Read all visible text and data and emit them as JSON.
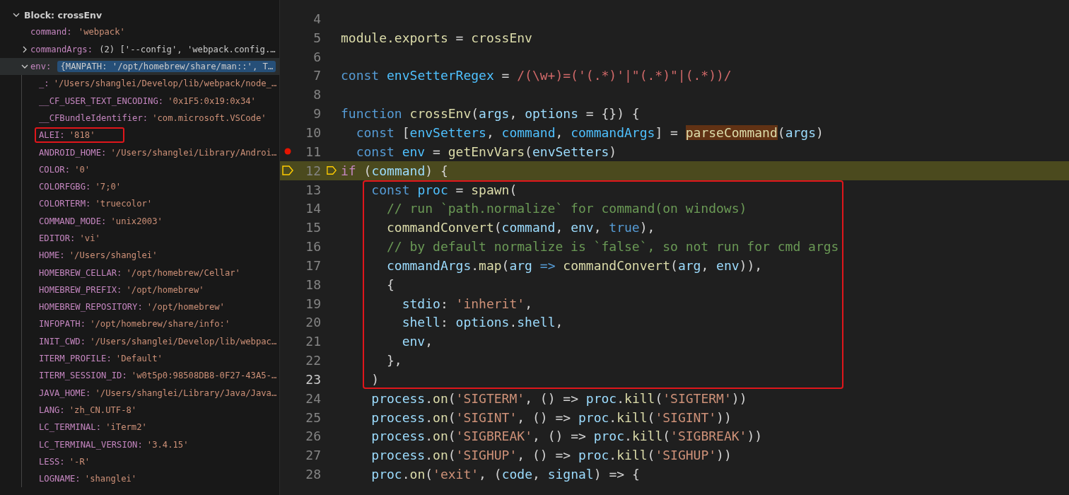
{
  "variables": {
    "scopes": [
      {
        "label": "Block: crossEnv",
        "expanded": true,
        "children": [
          {
            "name": "command:",
            "value": "'webpack'",
            "selected": false,
            "annotated": false
          },
          {
            "name": "commandArgs:",
            "value": "(2) ['--config', 'webpack.config.…",
            "expanded": false,
            "selected": false,
            "annotated": false
          },
          {
            "name": "env:",
            "value": "{MANPATH: '/opt/homebrew/share/man::', T…",
            "expanded": true,
            "selected": true,
            "annotated": false,
            "children": [
              {
                "name": "_:",
                "value": "'/Users/shanglei/Develop/lib/webpack/node_…",
                "selected": false,
                "annotated": false
              },
              {
                "name": "__CF_USER_TEXT_ENCODING:",
                "value": "'0x1F5:0x19:0x34'",
                "selected": false,
                "annotated": false
              },
              {
                "name": "__CFBundleIdentifier:",
                "value": "'com.microsoft.VSCode'",
                "selected": false,
                "annotated": false
              },
              {
                "name": "ALEI:",
                "value": "'818'",
                "selected": false,
                "annotated": true
              },
              {
                "name": "ANDROID_HOME:",
                "value": "'/Users/shanglei/Library/Androi…",
                "selected": false,
                "annotated": false
              },
              {
                "name": "COLOR:",
                "value": "'0'",
                "selected": false,
                "annotated": false
              },
              {
                "name": "COLORFGBG:",
                "value": "'7;0'",
                "selected": false,
                "annotated": false
              },
              {
                "name": "COLORTERM:",
                "value": "'truecolor'",
                "selected": false,
                "annotated": false
              },
              {
                "name": "COMMAND_MODE:",
                "value": "'unix2003'",
                "selected": false,
                "annotated": false
              },
              {
                "name": "EDITOR:",
                "value": "'vi'",
                "selected": false,
                "annotated": false
              },
              {
                "name": "HOME:",
                "value": "'/Users/shanglei'",
                "selected": false,
                "annotated": false
              },
              {
                "name": "HOMEBREW_CELLAR:",
                "value": "'/opt/homebrew/Cellar'",
                "selected": false,
                "annotated": false
              },
              {
                "name": "HOMEBREW_PREFIX:",
                "value": "'/opt/homebrew'",
                "selected": false,
                "annotated": false
              },
              {
                "name": "HOMEBREW_REPOSITORY:",
                "value": "'/opt/homebrew'",
                "selected": false,
                "annotated": false
              },
              {
                "name": "INFOPATH:",
                "value": "'/opt/homebrew/share/info:'",
                "selected": false,
                "annotated": false
              },
              {
                "name": "INIT_CWD:",
                "value": "'/Users/shanglei/Develop/lib/webpac…",
                "selected": false,
                "annotated": false
              },
              {
                "name": "ITERM_PROFILE:",
                "value": "'Default'",
                "selected": false,
                "annotated": false
              },
              {
                "name": "ITERM_SESSION_ID:",
                "value": "'w0t5p0:98508DB8-0F27-43A5-…",
                "selected": false,
                "annotated": false
              },
              {
                "name": "JAVA_HOME:",
                "value": "'/Users/shanglei/Library/Java/Java…",
                "selected": false,
                "annotated": false
              },
              {
                "name": "LANG:",
                "value": "'zh_CN.UTF-8'",
                "selected": false,
                "annotated": false
              },
              {
                "name": "LC_TERMINAL:",
                "value": "'iTerm2'",
                "selected": false,
                "annotated": false
              },
              {
                "name": "LC_TERMINAL_VERSION:",
                "value": "'3.4.15'",
                "selected": false,
                "annotated": false
              },
              {
                "name": "LESS:",
                "value": "'-R'",
                "selected": false,
                "annotated": false
              },
              {
                "name": "LOGNAME:",
                "value": "'shanglei'",
                "selected": false,
                "annotated": false
              }
            ]
          }
        ]
      }
    ]
  },
  "editor": {
    "lines": [
      {
        "number": "4",
        "breakpoint": false,
        "current": false,
        "boxed": false
      },
      {
        "number": "5",
        "breakpoint": false,
        "current": false,
        "boxed": false,
        "tokens": [
          {
            "text": "module.exports",
            "kind": "fn"
          },
          {
            "text": " = ",
            "kind": "punct"
          },
          {
            "text": "crossEnv",
            "kind": "fn"
          }
        ]
      },
      {
        "number": "6",
        "breakpoint": false,
        "current": false,
        "boxed": false
      },
      {
        "number": "7",
        "breakpoint": false,
        "current": false,
        "boxed": false,
        "tokens": [
          {
            "text": "const ",
            "kind": "kw"
          },
          {
            "text": "envSetterRegex",
            "kind": "const"
          },
          {
            "text": " = ",
            "kind": "punct"
          },
          {
            "text": "/(\\w+)=('(.*)'|\"(.*)\"|(.*))/",
            "kind": "regex"
          }
        ]
      },
      {
        "number": "8",
        "breakpoint": false,
        "current": false,
        "boxed": false
      },
      {
        "number": "9",
        "breakpoint": false,
        "current": false,
        "boxed": false,
        "tokens": [
          {
            "text": "function ",
            "kind": "kw"
          },
          {
            "text": "crossEnv",
            "kind": "fn"
          },
          {
            "text": "(",
            "kind": "punct"
          },
          {
            "text": "args",
            "kind": "var"
          },
          {
            "text": ", ",
            "kind": "punct"
          },
          {
            "text": "options",
            "kind": "var"
          },
          {
            "text": " = {}) {",
            "kind": "punct"
          }
        ]
      },
      {
        "number": "10",
        "breakpoint": false,
        "current": false,
        "boxed": false,
        "tokens": [
          {
            "text": "  const",
            "kind": "kw"
          },
          {
            "text": " [",
            "kind": "punct"
          },
          {
            "text": "envSetters",
            "kind": "const"
          },
          {
            "text": ", ",
            "kind": "punct"
          },
          {
            "text": "command",
            "kind": "const"
          },
          {
            "text": ", ",
            "kind": "punct"
          },
          {
            "text": "commandArgs",
            "kind": "const"
          },
          {
            "text": "] = ",
            "kind": "punct"
          },
          {
            "text": "parseCommand",
            "kind": "match"
          },
          {
            "text": "(",
            "kind": "punct"
          },
          {
            "text": "args",
            "kind": "var"
          },
          {
            "text": ")",
            "kind": "punct"
          }
        ]
      },
      {
        "number": "11",
        "breakpoint": true,
        "current": false,
        "boxed": false,
        "tokens": [
          {
            "text": "  const",
            "kind": "kw"
          },
          {
            "text": " env",
            "kind": "const"
          },
          {
            "text": " = ",
            "kind": "punct"
          },
          {
            "text": "getEnvVars",
            "kind": "fn"
          },
          {
            "text": "(",
            "kind": "punct"
          },
          {
            "text": "envSetters",
            "kind": "var"
          },
          {
            "text": ")",
            "kind": "punct"
          }
        ]
      },
      {
        "number": "12",
        "breakpoint": false,
        "current": true,
        "boxed": false,
        "tokens": [
          {
            "text": "if",
            "kind": "ctrl"
          },
          {
            "text": " (",
            "kind": "punct"
          },
          {
            "text": "command",
            "kind": "var"
          },
          {
            "text": ") {",
            "kind": "punct"
          }
        ]
      },
      {
        "number": "13",
        "breakpoint": false,
        "current": false,
        "boxed": true,
        "tokens": [
          {
            "text": "    const",
            "kind": "kw"
          },
          {
            "text": " proc",
            "kind": "const"
          },
          {
            "text": " = ",
            "kind": "punct"
          },
          {
            "text": "spawn",
            "kind": "fn"
          },
          {
            "text": "(",
            "kind": "punct"
          }
        ]
      },
      {
        "number": "14",
        "breakpoint": false,
        "current": false,
        "boxed": true,
        "tokens": [
          {
            "text": "      // run `path.normalize` for command(on windows)",
            "kind": "comment"
          }
        ]
      },
      {
        "number": "15",
        "breakpoint": false,
        "current": false,
        "boxed": true,
        "tokens": [
          {
            "text": "      commandConvert",
            "kind": "fn"
          },
          {
            "text": "(",
            "kind": "punct"
          },
          {
            "text": "command",
            "kind": "var"
          },
          {
            "text": ", ",
            "kind": "punct"
          },
          {
            "text": "env",
            "kind": "var"
          },
          {
            "text": ", ",
            "kind": "punct"
          },
          {
            "text": "true",
            "kind": "kw"
          },
          {
            "text": "),",
            "kind": "punct"
          }
        ]
      },
      {
        "number": "16",
        "breakpoint": false,
        "current": false,
        "boxed": true,
        "tokens": [
          {
            "text": "      // by default normalize is `false`, so not run for cmd args",
            "kind": "comment"
          }
        ]
      },
      {
        "number": "17",
        "breakpoint": false,
        "current": false,
        "boxed": true,
        "tokens": [
          {
            "text": "      commandArgs",
            "kind": "var"
          },
          {
            "text": ".",
            "kind": "punct"
          },
          {
            "text": "map",
            "kind": "fn"
          },
          {
            "text": "(",
            "kind": "punct"
          },
          {
            "text": "arg",
            "kind": "var"
          },
          {
            "text": " => ",
            "kind": "kw"
          },
          {
            "text": "commandConvert",
            "kind": "fn"
          },
          {
            "text": "(",
            "kind": "punct"
          },
          {
            "text": "arg",
            "kind": "var"
          },
          {
            "text": ", ",
            "kind": "punct"
          },
          {
            "text": "env",
            "kind": "var"
          },
          {
            "text": ")),",
            "kind": "punct"
          }
        ]
      },
      {
        "number": "18",
        "breakpoint": false,
        "current": false,
        "boxed": true,
        "tokens": [
          {
            "text": "      {",
            "kind": "punct"
          }
        ]
      },
      {
        "number": "19",
        "breakpoint": false,
        "current": false,
        "boxed": true,
        "tokens": [
          {
            "text": "        stdio",
            "kind": "var"
          },
          {
            "text": ": ",
            "kind": "punct"
          },
          {
            "text": "'inherit'",
            "kind": "str"
          },
          {
            "text": ",",
            "kind": "punct"
          }
        ]
      },
      {
        "number": "20",
        "breakpoint": false,
        "current": false,
        "boxed": true,
        "tokens": [
          {
            "text": "        shell",
            "kind": "var"
          },
          {
            "text": ": ",
            "kind": "punct"
          },
          {
            "text": "options",
            "kind": "var"
          },
          {
            "text": ".",
            "kind": "punct"
          },
          {
            "text": "shell",
            "kind": "var"
          },
          {
            "text": ",",
            "kind": "punct"
          }
        ]
      },
      {
        "number": "21",
        "breakpoint": false,
        "current": false,
        "boxed": true,
        "tokens": [
          {
            "text": "        env",
            "kind": "var"
          },
          {
            "text": ",",
            "kind": "punct"
          }
        ]
      },
      {
        "number": "22",
        "breakpoint": false,
        "current": false,
        "boxed": true,
        "tokens": [
          {
            "text": "      },",
            "kind": "punct"
          }
        ]
      },
      {
        "number": "23",
        "breakpoint": false,
        "current": false,
        "boxed": true,
        "tokens": [
          {
            "text": "    )",
            "kind": "punct"
          }
        ]
      },
      {
        "number": "24",
        "breakpoint": false,
        "current": false,
        "boxed": false,
        "tokens": [
          {
            "text": "    process",
            "kind": "var"
          },
          {
            "text": ".",
            "kind": "punct"
          },
          {
            "text": "on",
            "kind": "fn"
          },
          {
            "text": "(",
            "kind": "punct"
          },
          {
            "text": "'SIGTERM'",
            "kind": "str"
          },
          {
            "text": ", () => ",
            "kind": "punct"
          },
          {
            "text": "proc",
            "kind": "var"
          },
          {
            "text": ".",
            "kind": "punct"
          },
          {
            "text": "kill",
            "kind": "fn"
          },
          {
            "text": "(",
            "kind": "punct"
          },
          {
            "text": "'SIGTERM'",
            "kind": "str"
          },
          {
            "text": "))",
            "kind": "punct"
          }
        ]
      },
      {
        "number": "25",
        "breakpoint": false,
        "current": false,
        "boxed": false,
        "tokens": [
          {
            "text": "    process",
            "kind": "var"
          },
          {
            "text": ".",
            "kind": "punct"
          },
          {
            "text": "on",
            "kind": "fn"
          },
          {
            "text": "(",
            "kind": "punct"
          },
          {
            "text": "'SIGINT'",
            "kind": "str"
          },
          {
            "text": ", () => ",
            "kind": "punct"
          },
          {
            "text": "proc",
            "kind": "var"
          },
          {
            "text": ".",
            "kind": "punct"
          },
          {
            "text": "kill",
            "kind": "fn"
          },
          {
            "text": "(",
            "kind": "punct"
          },
          {
            "text": "'SIGINT'",
            "kind": "str"
          },
          {
            "text": "))",
            "kind": "punct"
          }
        ]
      },
      {
        "number": "26",
        "breakpoint": false,
        "current": false,
        "boxed": false,
        "tokens": [
          {
            "text": "    process",
            "kind": "var"
          },
          {
            "text": ".",
            "kind": "punct"
          },
          {
            "text": "on",
            "kind": "fn"
          },
          {
            "text": "(",
            "kind": "punct"
          },
          {
            "text": "'SIGBREAK'",
            "kind": "str"
          },
          {
            "text": ", () => ",
            "kind": "punct"
          },
          {
            "text": "proc",
            "kind": "var"
          },
          {
            "text": ".",
            "kind": "punct"
          },
          {
            "text": "kill",
            "kind": "fn"
          },
          {
            "text": "(",
            "kind": "punct"
          },
          {
            "text": "'SIGBREAK'",
            "kind": "str"
          },
          {
            "text": "))",
            "kind": "punct"
          }
        ]
      },
      {
        "number": "27",
        "breakpoint": false,
        "current": false,
        "boxed": false,
        "tokens": [
          {
            "text": "    process",
            "kind": "var"
          },
          {
            "text": ".",
            "kind": "punct"
          },
          {
            "text": "on",
            "kind": "fn"
          },
          {
            "text": "(",
            "kind": "punct"
          },
          {
            "text": "'SIGHUP'",
            "kind": "str"
          },
          {
            "text": ", () => ",
            "kind": "punct"
          },
          {
            "text": "proc",
            "kind": "var"
          },
          {
            "text": ".",
            "kind": "punct"
          },
          {
            "text": "kill",
            "kind": "fn"
          },
          {
            "text": "(",
            "kind": "punct"
          },
          {
            "text": "'SIGHUP'",
            "kind": "str"
          },
          {
            "text": "))",
            "kind": "punct"
          }
        ]
      },
      {
        "number": "28",
        "breakpoint": false,
        "current": false,
        "boxed": false,
        "tokens": [
          {
            "text": "    proc",
            "kind": "var"
          },
          {
            "text": ".",
            "kind": "punct"
          },
          {
            "text": "on",
            "kind": "fn"
          },
          {
            "text": "(",
            "kind": "punct"
          },
          {
            "text": "'exit'",
            "kind": "str"
          },
          {
            "text": ", (",
            "kind": "punct"
          },
          {
            "text": "code",
            "kind": "var"
          },
          {
            "text": ", ",
            "kind": "punct"
          },
          {
            "text": "signal",
            "kind": "var"
          },
          {
            "text": ") => {",
            "kind": "punct"
          }
        ]
      }
    ]
  }
}
